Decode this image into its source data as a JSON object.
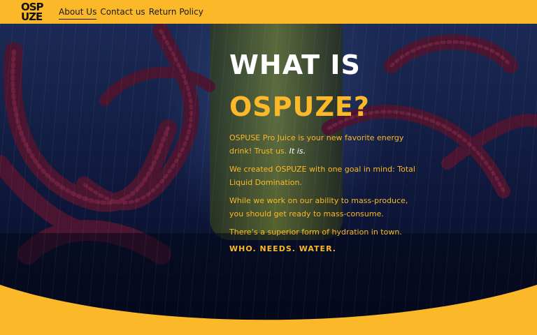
{
  "header": {
    "logo_line1": "OSP",
    "logo_line2": "UZE",
    "nav": [
      {
        "label": "About Us",
        "active": true
      },
      {
        "label": "Contact us",
        "active": false
      },
      {
        "label": "Return Policy",
        "active": false
      }
    ]
  },
  "hero": {
    "title_line1": "WHAT IS",
    "title_line2": "OSPUZE?",
    "p1_text": "OSPUSE Pro Juice is your new favorite energy drink! Trust us.",
    "p1_emphasis": "It is.",
    "p2": "We created OSPUZE with one goal in mind: Total Liquid Domination.",
    "p3": "While we work on our ability to mass-produce, you should get ready to mass-consume.",
    "p4": "There’s a superior form of hydration in town.",
    "tagline": "WHO. NEEDS. WATER."
  },
  "colors": {
    "brand_yellow": "#fbb829",
    "background_navy": "#0a1030",
    "tentacle_purple": "#5a1a35"
  },
  "icons": {
    "background": "tentacles-can-illustration"
  }
}
